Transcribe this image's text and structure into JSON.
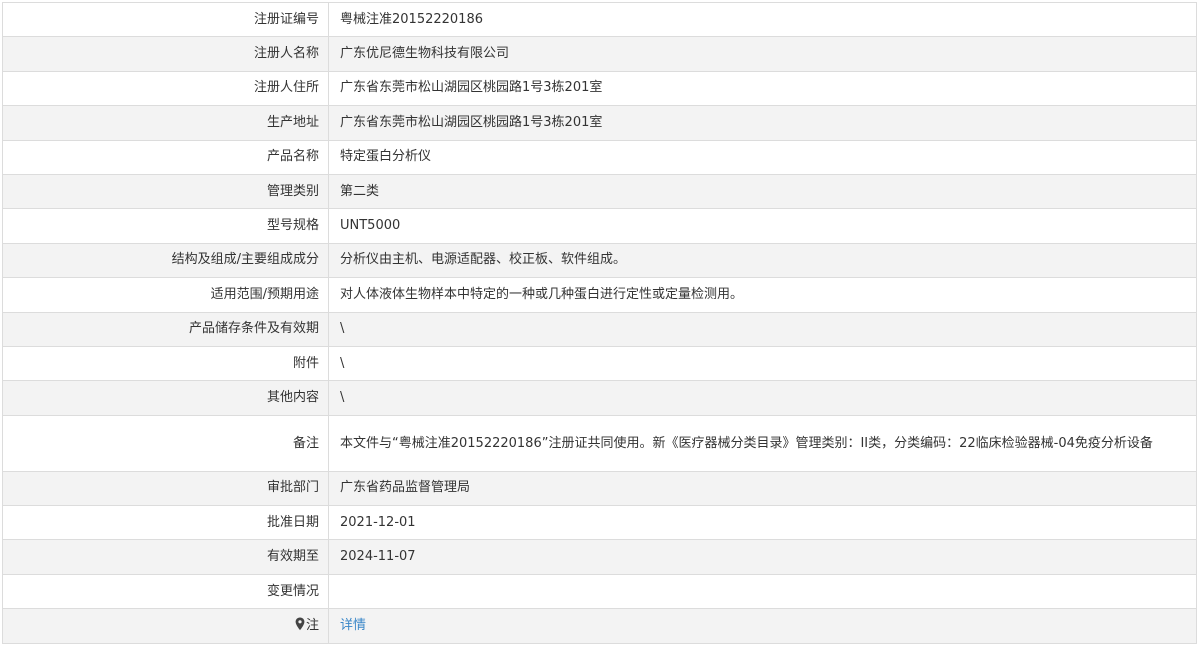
{
  "rows": [
    {
      "label": "注册证编号",
      "value": "粤械注准20152220186"
    },
    {
      "label": "注册人名称",
      "value": "广东优尼德生物科技有限公司"
    },
    {
      "label": "注册人住所",
      "value": "广东省东莞市松山湖园区桃园路1号3栋201室"
    },
    {
      "label": "生产地址",
      "value": "广东省东莞市松山湖园区桃园路1号3栋201室"
    },
    {
      "label": "产品名称",
      "value": "特定蛋白分析仪"
    },
    {
      "label": "管理类别",
      "value": "第二类"
    },
    {
      "label": "型号规格",
      "value": "UNT5000"
    },
    {
      "label": "结构及组成/主要组成成分",
      "value": "分析仪由主机、电源适配器、校正板、软件组成。"
    },
    {
      "label": "适用范围/预期用途",
      "value": "对人体液体生物样本中特定的一种或几种蛋白进行定性或定量检测用。"
    },
    {
      "label": "产品储存条件及有效期",
      "value": "\\"
    },
    {
      "label": "附件",
      "value": "\\"
    },
    {
      "label": "其他内容",
      "value": "\\"
    },
    {
      "label": "备注",
      "value": "本文件与“粤械注准20152220186”注册证共同使用。新《医疗器械分类目录》管理类别：II类，分类编码：22临床检验器械-04免疫分析设备"
    },
    {
      "label": "审批部门",
      "value": "广东省药品监督管理局"
    },
    {
      "label": "批准日期",
      "value": "2021-12-01"
    },
    {
      "label": "有效期至",
      "value": "2024-11-07"
    },
    {
      "label": "变更情况",
      "value": ""
    }
  ],
  "note": {
    "label": "注",
    "link_text": "详情",
    "icon": "map-pin-icon"
  }
}
